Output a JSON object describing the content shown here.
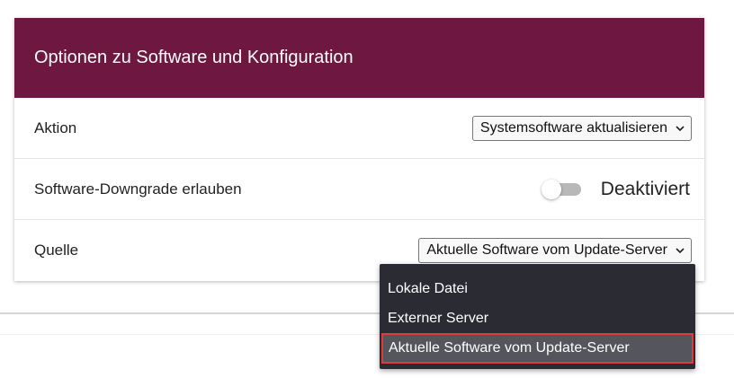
{
  "panel": {
    "title": "Optionen zu Software und Konfiguration",
    "header_color": "#6e1740"
  },
  "rows": {
    "aktion": {
      "label": "Aktion",
      "value": "Systemsoftware aktualisieren"
    },
    "downgrade": {
      "label": "Software-Downgrade erlauben",
      "state_label": "Deaktiviert",
      "enabled": false
    },
    "quelle": {
      "label": "Quelle",
      "value": "Aktuelle Software vom Update-Server"
    }
  },
  "dropdown": {
    "options": [
      "Lokale Datei",
      "Externer Server",
      "Aktuelle Software vom Update-Server"
    ],
    "selected": "Aktuelle Software vom Update-Server",
    "highlight_color": "#e03a3a"
  },
  "icons": {
    "select_arrow": "chevron-down-icon"
  }
}
